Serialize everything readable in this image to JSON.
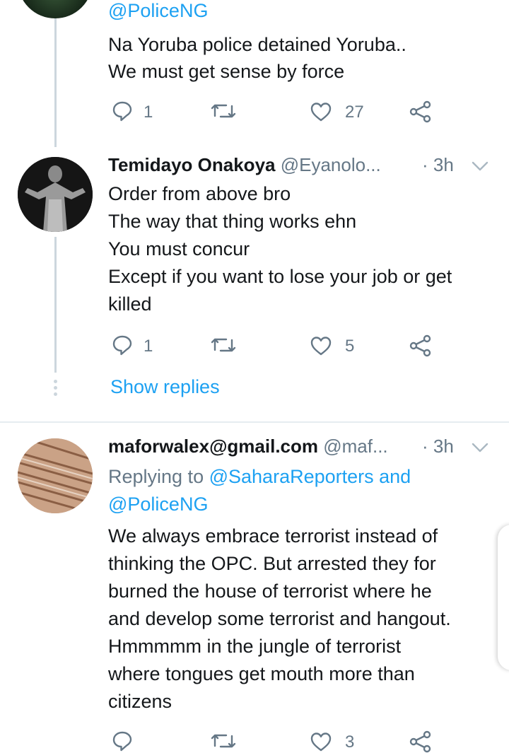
{
  "tweet1": {
    "mention_tail": "@PoliceNG",
    "lines": [
      "Na Yoruba police detained Yoruba..",
      "We must get sense by force"
    ],
    "replies": "1",
    "likes": "27"
  },
  "tweet2": {
    "name": "Temidayo Onakoya",
    "handle": "@Eyanolo...",
    "time": "· 3h",
    "lines": [
      "Order from above bro",
      "The way that thing works ehn",
      "You must concur",
      "Except if you want to lose your job or get",
      "killed"
    ],
    "replies": "1",
    "likes": "5"
  },
  "show_replies": "Show replies",
  "tweet3": {
    "name": "maforwalex@gmail.com",
    "handle": "@maf...",
    "time": "· 3h",
    "replying_prefix": "Replying to",
    "replying_to_1": "@SaharaReporters and",
    "replying_to_2": "@PoliceNG",
    "lines": [
      "We always embrace terrorist instead of",
      "thinking the OPC. But arrested they for",
      "burned the house of terrorist where he",
      "and develop some terrorist and hangout.",
      "Hmmmmm in the jungle of terrorist",
      "where tongues get mouth more than",
      "citizens"
    ],
    "likes": "3"
  },
  "colors": {
    "accent": "#1da1f2",
    "secondary": "#657786",
    "like_red": "#e0245e"
  }
}
